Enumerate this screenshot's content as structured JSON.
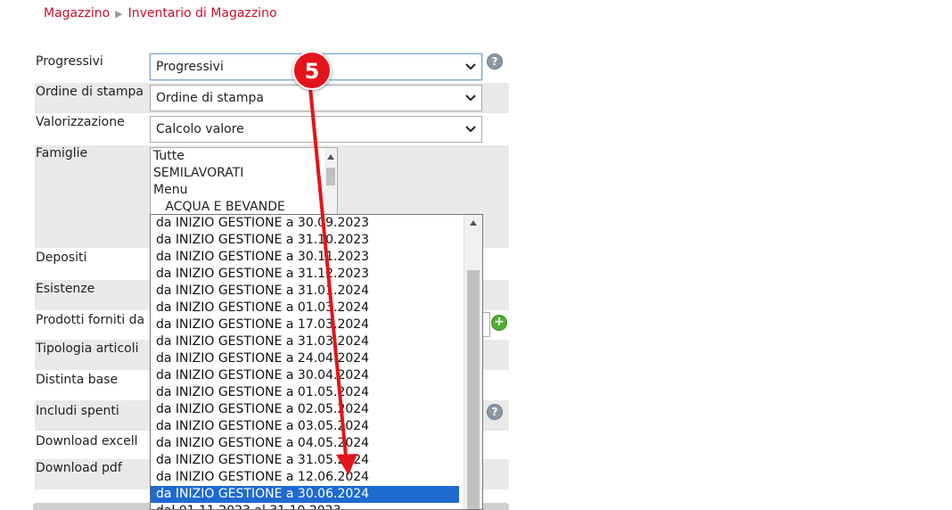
{
  "breadcrumb": {
    "section": "Magazzino",
    "page": "Inventario di Magazzino"
  },
  "form": {
    "progressivi": {
      "label": "Progressivi",
      "value": "Progressivi"
    },
    "ordine": {
      "label": "Ordine di stampa",
      "value": "Ordine di stampa"
    },
    "valorizzazione": {
      "label": "Valorizzazione",
      "value": "Calcolo valore"
    },
    "famiglie": {
      "label": "Famiglie",
      "items": [
        "Tutte",
        "SEMILAVORATI",
        "Menu",
        "   ACQUA E BEVANDE"
      ]
    },
    "depositi": {
      "label": "Depositi"
    },
    "esistenze": {
      "label": "Esistenze"
    },
    "prodotti_forniti": {
      "label": "Prodotti forniti da"
    },
    "tipologia": {
      "label": "Tipologia articoli"
    },
    "distinta": {
      "label": "Distinta base"
    },
    "includi_spenti": {
      "label": "Includi spenti"
    },
    "download_excel": {
      "label": "Download excell"
    },
    "download_pdf": {
      "label": "Download pdf"
    },
    "help_symbol": "?",
    "plus_symbol": "+"
  },
  "dropdown": {
    "options": [
      "da INIZIO GESTIONE a 30.09.2023",
      "da INIZIO GESTIONE a 31.10.2023",
      "da INIZIO GESTIONE a 30.11.2023",
      "da INIZIO GESTIONE a 31.12.2023",
      "da INIZIO GESTIONE a 31.01.2024",
      "da INIZIO GESTIONE a 01.03.2024",
      "da INIZIO GESTIONE a 17.03.2024",
      "da INIZIO GESTIONE a 31.03.2024",
      "da INIZIO GESTIONE a 24.04.2024",
      "da INIZIO GESTIONE a 30.04.2024",
      "da INIZIO GESTIONE a 01.05.2024",
      "da INIZIO GESTIONE a 02.05.2024",
      "da INIZIO GESTIONE a 03.05.2024",
      "da INIZIO GESTIONE a 04.05.2024",
      "da INIZIO GESTIONE a 31.05.2024",
      "da INIZIO GESTIONE a 12.06.2024",
      "da INIZIO GESTIONE a 30.06.2024",
      "dal 01.11.2023 al 31.10.2023"
    ],
    "selected_value": "da INIZIO GESTIONE a 30.06.2024"
  },
  "annotation": {
    "step": "5",
    "color": "#e4141b"
  },
  "colors": {
    "accent": "#c8102e",
    "selection": "#1f6ad0",
    "row_shade": "#e9e9e9"
  }
}
